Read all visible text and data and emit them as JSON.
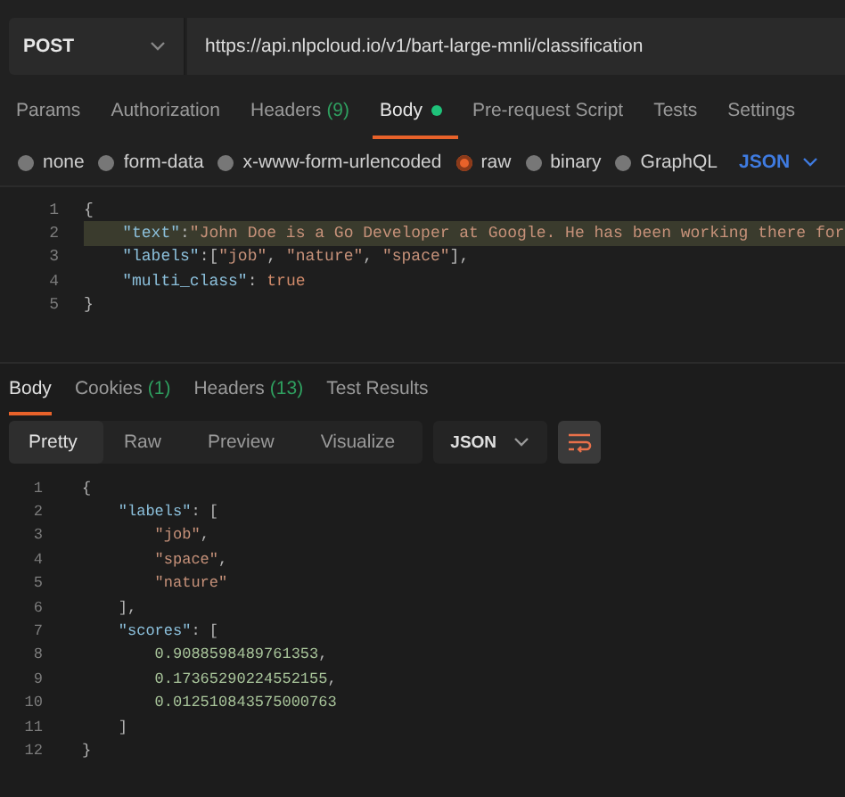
{
  "request": {
    "method": "POST",
    "url": "https://api.nlpcloud.io/v1/bart-large-mnli/classification"
  },
  "request_tabs": [
    {
      "label": "Params",
      "selected": false
    },
    {
      "label": "Authorization",
      "selected": false
    },
    {
      "label": "Headers",
      "count": "(9)",
      "selected": false
    },
    {
      "label": "Body",
      "selected": true,
      "dot": true
    },
    {
      "label": "Pre-request Script",
      "selected": false
    },
    {
      "label": "Tests",
      "selected": false
    },
    {
      "label": "Settings",
      "selected": false
    }
  ],
  "body_types": [
    {
      "label": "none",
      "selected": false
    },
    {
      "label": "form-data",
      "selected": false
    },
    {
      "label": "x-www-form-urlencoded",
      "selected": false
    },
    {
      "label": "raw",
      "selected": true
    },
    {
      "label": "binary",
      "selected": false
    },
    {
      "label": "GraphQL",
      "selected": false
    }
  ],
  "body_format": "JSON",
  "request_editor": {
    "lines": [
      {
        "number": "1",
        "highlighted": false,
        "tokens": [
          {
            "kind": "punct",
            "text": "{"
          }
        ]
      },
      {
        "number": "2",
        "highlighted": true,
        "tokens": [
          {
            "kind": "key",
            "text": "    \"text\""
          },
          {
            "kind": "punct",
            "text": ":"
          },
          {
            "kind": "string",
            "text": "\"John Doe is a Go Developer at Google. He has been working there for"
          }
        ]
      },
      {
        "number": "3",
        "highlighted": false,
        "tokens": [
          {
            "kind": "key",
            "text": "    \"labels\""
          },
          {
            "kind": "punct",
            "text": ":["
          },
          {
            "kind": "string",
            "text": "\"job\""
          },
          {
            "kind": "punct",
            "text": ", "
          },
          {
            "kind": "string",
            "text": "\"nature\""
          },
          {
            "kind": "punct",
            "text": ", "
          },
          {
            "kind": "string",
            "text": "\"space\""
          },
          {
            "kind": "punct",
            "text": "],"
          }
        ]
      },
      {
        "number": "4",
        "highlighted": false,
        "tokens": [
          {
            "kind": "key",
            "text": "    \"multi_class\""
          },
          {
            "kind": "punct",
            "text": ": "
          },
          {
            "kind": "keyword",
            "text": "true"
          }
        ]
      },
      {
        "number": "5",
        "highlighted": false,
        "tokens": [
          {
            "kind": "punct",
            "text": "}"
          }
        ]
      }
    ]
  },
  "response_tabs": [
    {
      "label": "Body",
      "selected": true
    },
    {
      "label": "Cookies",
      "count": "(1)",
      "selected": false
    },
    {
      "label": "Headers",
      "count": "(13)",
      "selected": false
    },
    {
      "label": "Test Results",
      "selected": false
    }
  ],
  "view_modes": [
    {
      "label": "Pretty",
      "selected": true
    },
    {
      "label": "Raw",
      "selected": false
    },
    {
      "label": "Preview",
      "selected": false
    },
    {
      "label": "Visualize",
      "selected": false
    }
  ],
  "response_format": "JSON",
  "response_editor": {
    "lines": [
      {
        "number": "1",
        "tokens": [
          {
            "kind": "punct",
            "text": "{"
          }
        ]
      },
      {
        "number": "2",
        "tokens": [
          {
            "kind": "key",
            "text": "    \"labels\""
          },
          {
            "kind": "punct",
            "text": ": ["
          }
        ]
      },
      {
        "number": "3",
        "tokens": [
          {
            "kind": "string",
            "text": "        \"job\""
          },
          {
            "kind": "punct",
            "text": ","
          }
        ]
      },
      {
        "number": "4",
        "tokens": [
          {
            "kind": "string",
            "text": "        \"space\""
          },
          {
            "kind": "punct",
            "text": ","
          }
        ]
      },
      {
        "number": "5",
        "tokens": [
          {
            "kind": "string",
            "text": "        \"nature\""
          }
        ]
      },
      {
        "number": "6",
        "tokens": [
          {
            "kind": "punct",
            "text": "    ],"
          }
        ]
      },
      {
        "number": "7",
        "tokens": [
          {
            "kind": "key",
            "text": "    \"scores\""
          },
          {
            "kind": "punct",
            "text": ": ["
          }
        ]
      },
      {
        "number": "8",
        "tokens": [
          {
            "kind": "number",
            "text": "        0.9088598489761353"
          },
          {
            "kind": "punct",
            "text": ","
          }
        ]
      },
      {
        "number": "9",
        "tokens": [
          {
            "kind": "number",
            "text": "        0.17365290224552155"
          },
          {
            "kind": "punct",
            "text": ","
          }
        ]
      },
      {
        "number": "10",
        "tokens": [
          {
            "kind": "number",
            "text": "        0.012510843575000763"
          }
        ]
      },
      {
        "number": "11",
        "tokens": [
          {
            "kind": "punct",
            "text": "    ]"
          }
        ]
      },
      {
        "number": "12",
        "tokens": [
          {
            "kind": "punct",
            "text": "}"
          }
        ]
      }
    ]
  }
}
